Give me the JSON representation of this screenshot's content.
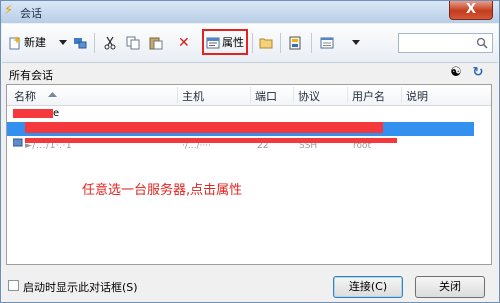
{
  "window": {
    "title": "会话",
    "close_label": "X"
  },
  "toolbar": {
    "new_label": "新建",
    "properties_label": "属性"
  },
  "section": {
    "label": "所有会话"
  },
  "list": {
    "columns": [
      "名称",
      "主机",
      "端口",
      "协议",
      "用户名",
      "说明"
    ],
    "row_fragment": "e",
    "visible_row_text": {
      "name": "►/.../1·.·1",
      "host": "·/.../····",
      "port": "22",
      "protocol": "SSH",
      "user": "root"
    }
  },
  "annotation": {
    "text": "任意选一台服务器,点击属性",
    "color": "#e0241f"
  },
  "footer": {
    "startup_checkbox_label": "启动时显示此对话框(S)",
    "startup_checked": false,
    "connect_label": "连接(C)",
    "close_label": "关闭"
  },
  "colors": {
    "highlight": "#e0241f",
    "selection": "#3390ee",
    "redaction": "#f5383c"
  },
  "icons": {
    "title": "lightning-icon",
    "new": "new-session-icon",
    "cut": "scissors-icon",
    "copy": "copy-icon",
    "paste": "paste-icon",
    "delete": "delete-x-icon",
    "properties": "properties-icon",
    "folder": "folder-icon",
    "layout": "layout-icon",
    "view": "view-icon",
    "search": "search-icon"
  }
}
